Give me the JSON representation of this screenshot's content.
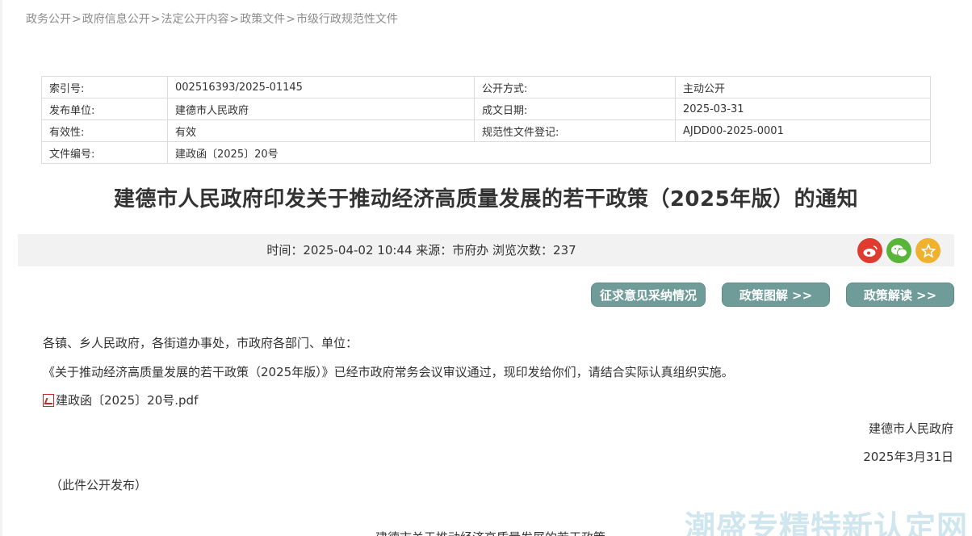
{
  "breadcrumb": [
    "政务公开",
    "政府信息公开",
    "法定公开内容",
    "政策文件",
    "市级行政规范性文件"
  ],
  "meta": {
    "index_label": "索引号:",
    "index_value": "002516393/2025-01145",
    "open_mode_label": "公开方式:",
    "open_mode_value": "主动公开",
    "publisher_label": "发布单位:",
    "publisher_value": "建德市人民政府",
    "date_label": "成文日期:",
    "date_value": "2025-03-31",
    "validity_label": "有效性:",
    "validity_value": "有效",
    "reg_label": "规范性文件登记:",
    "reg_value": "AJDD00-2025-0001",
    "docno_label": "文件编号:",
    "docno_value": "建政函〔2025〕20号"
  },
  "title": "建德市人民政府印发关于推动经济高质量发展的若干政策（2025年版）的通知",
  "info": "时间：2025-04-02 10:44 来源：市府办 浏览次数：237",
  "share_icons": [
    "weibo-icon",
    "wechat-icon",
    "favorite-icon"
  ],
  "buttons": {
    "feedback": "征求意见采纳情况",
    "graphic": "政策图解 >>",
    "interpret": "政策解读 >>"
  },
  "body": {
    "salutation": "各镇、乡人民政府，各街道办事处，市政府各部门、单位：",
    "paragraph": "《关于推动经济高质量发展的若干政策（2025年版）》已经市政府常务会议审议通过，现印发给你们，请结合实际认真组织实施。",
    "attachment": "建政函〔2025〕20号.pdf",
    "signer": "建德市人民政府",
    "sign_date": "2025年3月31日",
    "note": "（此件公开发布）",
    "cut_line": "建德市关于推动经济高质量发展的若干政策"
  },
  "watermark": "潮盛专精特新认定网",
  "colors": {
    "button": "#6f9b98",
    "weibo": "#e03b2f",
    "wechat": "#59b43a",
    "favorite": "#f0b12e",
    "info_bar": "#f2f2f2"
  }
}
